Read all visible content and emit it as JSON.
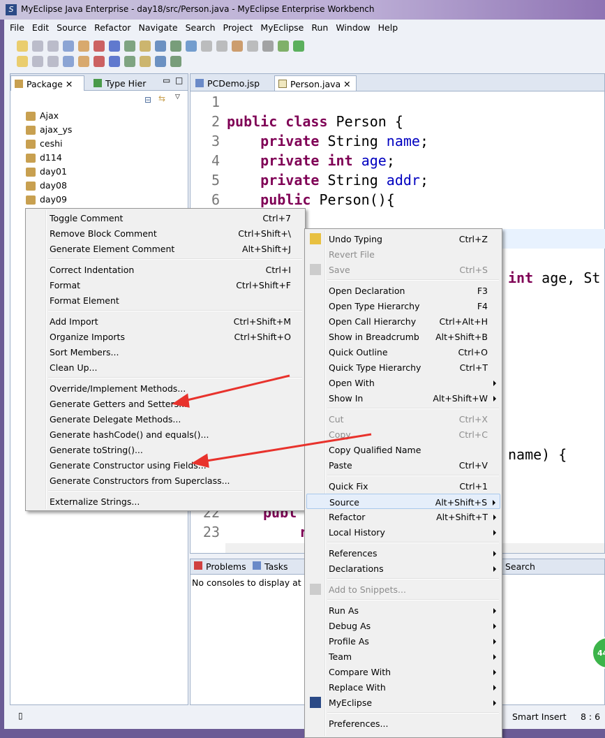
{
  "window": {
    "title": "MyEclipse Java Enterprise - day18/src/Person.java - MyEclipse Enterprise Workbench"
  },
  "menubar": [
    "File",
    "Edit",
    "Source",
    "Refactor",
    "Navigate",
    "Search",
    "Project",
    "MyEclipse",
    "Run",
    "Window",
    "Help"
  ],
  "left_panel": {
    "tabs": [
      "Package",
      "Type Hier"
    ],
    "projects": [
      "Ajax",
      "ajax_ys",
      "ceshi",
      "d114",
      "day01",
      "day08",
      "day09"
    ]
  },
  "editor": {
    "tabs": [
      "PCDemo.jsp",
      "Person.java"
    ],
    "active_tab": "Person.java",
    "lines": [
      {
        "n": "1",
        "code": ""
      },
      {
        "n": "2",
        "code": "public class Person {"
      },
      {
        "n": "3",
        "code": "    private String name;"
      },
      {
        "n": "4",
        "code": "    private int age;"
      },
      {
        "n": "5",
        "code": "    private String addr;"
      },
      {
        "n": "6",
        "code": "    public Person(){"
      }
    ],
    "fragments": [
      "int age, St",
      "name) {",
      "publ",
      "r"
    ],
    "fragment_lines": [
      "22",
      "23"
    ]
  },
  "bottom_panel": {
    "tabs": [
      "Problems",
      "Tasks",
      "Search"
    ],
    "message": "No consoles to display at th"
  },
  "status": {
    "mode": "Smart Insert",
    "position": "8 : 6"
  },
  "badge": "44",
  "source_menu": [
    {
      "label": "Toggle Comment",
      "shortcut": "Ctrl+7"
    },
    {
      "label": "Remove Block Comment",
      "shortcut": "Ctrl+Shift+\\"
    },
    {
      "label": "Generate Element Comment",
      "shortcut": "Alt+Shift+J"
    },
    {
      "sep": true
    },
    {
      "label": "Correct Indentation",
      "shortcut": "Ctrl+I"
    },
    {
      "label": "Format",
      "shortcut": "Ctrl+Shift+F"
    },
    {
      "label": "Format Element",
      "shortcut": ""
    },
    {
      "sep": true
    },
    {
      "label": "Add Import",
      "shortcut": "Ctrl+Shift+M"
    },
    {
      "label": "Organize Imports",
      "shortcut": "Ctrl+Shift+O"
    },
    {
      "label": "Sort Members...",
      "shortcut": ""
    },
    {
      "label": "Clean Up...",
      "shortcut": ""
    },
    {
      "sep": true
    },
    {
      "label": "Override/Implement Methods...",
      "shortcut": ""
    },
    {
      "label": "Generate Getters and Setters...",
      "shortcut": ""
    },
    {
      "label": "Generate Delegate Methods...",
      "shortcut": ""
    },
    {
      "label": "Generate hashCode() and equals()...",
      "shortcut": ""
    },
    {
      "label": "Generate toString()...",
      "shortcut": ""
    },
    {
      "label": "Generate Constructor using Fields...",
      "shortcut": ""
    },
    {
      "label": "Generate Constructors from Superclass...",
      "shortcut": ""
    },
    {
      "sep": true
    },
    {
      "label": "Externalize Strings...",
      "shortcut": ""
    }
  ],
  "context_menu": [
    {
      "label": "Undo Typing",
      "shortcut": "Ctrl+Z",
      "icon": "undo-icon"
    },
    {
      "label": "Revert File",
      "shortcut": "",
      "disabled": true
    },
    {
      "label": "Save",
      "shortcut": "Ctrl+S",
      "disabled": true,
      "icon": "save-icon"
    },
    {
      "sep": true
    },
    {
      "label": "Open Declaration",
      "shortcut": "F3"
    },
    {
      "label": "Open Type Hierarchy",
      "shortcut": "F4"
    },
    {
      "label": "Open Call Hierarchy",
      "shortcut": "Ctrl+Alt+H"
    },
    {
      "label": "Show in Breadcrumb",
      "shortcut": "Alt+Shift+B"
    },
    {
      "label": "Quick Outline",
      "shortcut": "Ctrl+O"
    },
    {
      "label": "Quick Type Hierarchy",
      "shortcut": "Ctrl+T"
    },
    {
      "label": "Open With",
      "shortcut": "",
      "sub": true
    },
    {
      "label": "Show In",
      "shortcut": "Alt+Shift+W",
      "sub": true
    },
    {
      "sep": true
    },
    {
      "label": "Cut",
      "shortcut": "Ctrl+X",
      "disabled": true
    },
    {
      "label": "Copy",
      "shortcut": "Ctrl+C",
      "disabled": true
    },
    {
      "label": "Copy Qualified Name",
      "shortcut": ""
    },
    {
      "label": "Paste",
      "shortcut": "Ctrl+V"
    },
    {
      "sep": true
    },
    {
      "label": "Quick Fix",
      "shortcut": "Ctrl+1"
    },
    {
      "label": "Source",
      "shortcut": "Alt+Shift+S",
      "sub": true,
      "highlighted": true
    },
    {
      "label": "Refactor",
      "shortcut": "Alt+Shift+T",
      "sub": true
    },
    {
      "label": "Local History",
      "shortcut": "",
      "sub": true
    },
    {
      "sep": true
    },
    {
      "label": "References",
      "shortcut": "",
      "sub": true
    },
    {
      "label": "Declarations",
      "shortcut": "",
      "sub": true
    },
    {
      "sep": true
    },
    {
      "label": "Add to Snippets...",
      "shortcut": "",
      "disabled": true,
      "icon": "snippet-icon"
    },
    {
      "sep": true
    },
    {
      "label": "Run As",
      "shortcut": "",
      "sub": true
    },
    {
      "label": "Debug As",
      "shortcut": "",
      "sub": true
    },
    {
      "label": "Profile As",
      "shortcut": "",
      "sub": true
    },
    {
      "label": "Team",
      "shortcut": "",
      "sub": true
    },
    {
      "label": "Compare With",
      "shortcut": "",
      "sub": true
    },
    {
      "label": "Replace With",
      "shortcut": "",
      "sub": true
    },
    {
      "label": "MyEclipse",
      "shortcut": "",
      "sub": true,
      "icon": "myeclipse-icon"
    },
    {
      "sep": true
    },
    {
      "label": "Preferences...",
      "shortcut": ""
    }
  ],
  "colors": {
    "keyword": "#7f0055",
    "field": "#0000c0",
    "arrow": "#e8322c",
    "highlight": "#e5eefa"
  }
}
